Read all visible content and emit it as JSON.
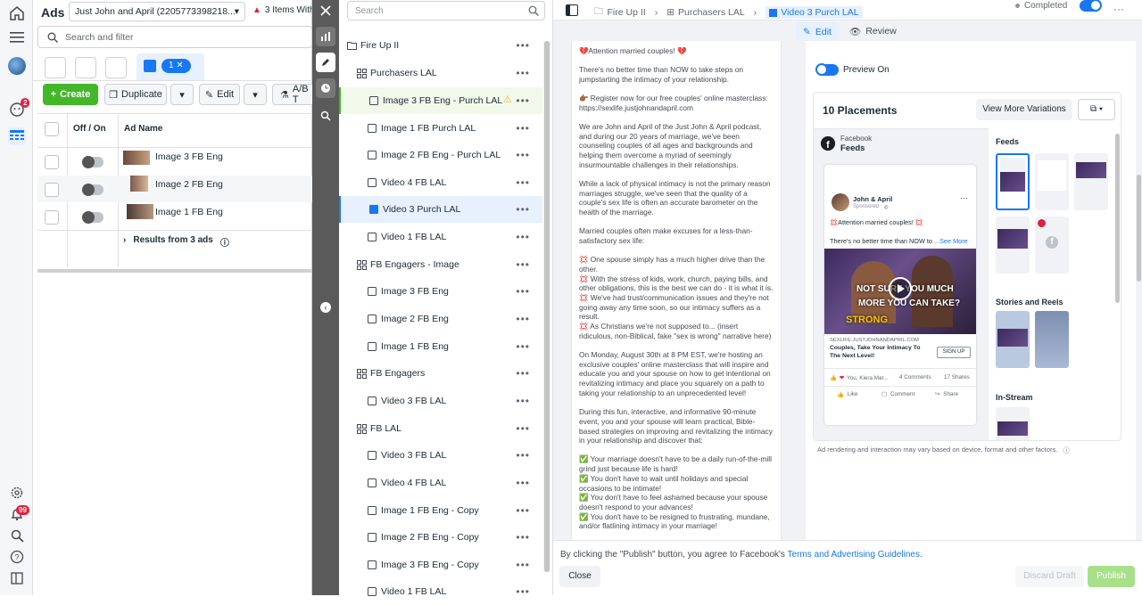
{
  "rail": {
    "notif_badge": "2",
    "alerts_badge": "99"
  },
  "ads": {
    "title": "Ads",
    "account": "Just John and April (2205773398218...",
    "warning": "3 Items With",
    "search_placeholder": "Search and filter",
    "selected_count": "1",
    "create": "Create",
    "duplicate": "Duplicate",
    "edit": "Edit",
    "ab": "A/B T",
    "col_onoff": "Off / On",
    "col_name": "Ad Name",
    "rows": [
      "Image 3 FB Eng",
      "Image 2 FB Eng",
      "Image 1 FB Eng"
    ],
    "results": "Results from 3 ads"
  },
  "tree": {
    "search_placeholder": "Search",
    "items": [
      {
        "label": "Fire Up II",
        "type": "campaign"
      },
      {
        "label": "Purchasers LAL",
        "type": "adset"
      },
      {
        "label": "Image 3 FB Eng - Purch LAL",
        "type": "ad",
        "warn": true
      },
      {
        "label": "Image 1 FB Purch LAL",
        "type": "ad"
      },
      {
        "label": "Image 2 FB Eng - Purch LAL",
        "type": "ad"
      },
      {
        "label": "Video 4 FB LAL",
        "type": "ad"
      },
      {
        "label": "Video 3 Purch LAL",
        "type": "ad",
        "selected": true
      },
      {
        "label": "Video 1 FB LAL",
        "type": "ad"
      },
      {
        "label": "FB Engagers - Image",
        "type": "adset"
      },
      {
        "label": "Image 3 FB Eng",
        "type": "ad"
      },
      {
        "label": "Image 2 FB Eng",
        "type": "ad"
      },
      {
        "label": "Image 1 FB Eng",
        "type": "ad"
      },
      {
        "label": "FB Engagers",
        "type": "adset"
      },
      {
        "label": "Video 3 FB LAL",
        "type": "ad"
      },
      {
        "label": "FB LAL",
        "type": "adset"
      },
      {
        "label": "Video 3 FB LAL",
        "type": "ad"
      },
      {
        "label": "Video 4 FB LAL",
        "type": "ad"
      },
      {
        "label": "Image 1 FB Eng - Copy",
        "type": "ad"
      },
      {
        "label": "Image 2 FB Eng - Copy",
        "type": "ad"
      },
      {
        "label": "Image 3 FB Eng - Copy",
        "type": "ad"
      },
      {
        "label": "Video 1 FB LAL",
        "type": "ad"
      }
    ]
  },
  "header": {
    "crumb1": "Fire Up II",
    "crumb2": "Purchasers LAL",
    "crumb3": "Video 3 Purch LAL",
    "status": "Completed",
    "edit_tab": "Edit",
    "review_tab": "Review"
  },
  "primary_text": [
    "💔Attention married couples! 💔",
    "There's no better time than NOW to take steps on jumpstarting the intimacy of your relationship.",
    "👉🏾 Register now for our free couples' online masterclass: https://sexlife.justjohnandapril.com",
    "We are John and April of the Just John & April podcast, and during our 20 years of marriage, we've been counseling couples of all ages and backgrounds and helping them overcome a myriad of seemingly insurmountable challenges in their relationships.",
    "While a lack of physical intimacy is not the primary reason marriages struggle, we've seen that the quality of a couple's sex life is often an accurate barometer on the health of the marriage.",
    "Married couples often make excuses for a less-than-satisfactory sex life:",
    "💢 One spouse simply has a much higher drive than the other.\n💢 With the stress of kids, work, church, paying bills, and other obligations, this is the best we can do - it is what it is.\n💢 We've had trust/communication issues and they're not going away any time soon, so our intimacy suffers as a result.\n💢 As Christians we're not supposed to... (insert ridiculous, non-Biblical, fake \"sex is wrong\" narrative here)",
    "On Monday, August 30th at 8 PM EST, we're hosting an exclusive couples' online masterclass that will inspire and educate you and your spouse on how to get intentional on revitalizing intimacy and place you squarely on a path to taking your relationship to an unprecedented level!",
    "During this fun, interactive, and informative 90-minute event, you and your spouse will learn practical, Bible-based strategies on improving and revitalizing the intimacy in your relationship and discover that:",
    "✅ Your marriage doesn't have to be a daily run-of-the-mill grind just because life is hard!\n✅ You don't have to wait until holidays and special occasions to be intimate!\n✅ You don't have to feel ashamed because your spouse doesn't respond to your advances!\n✅ You don't have to be resigned to frustrating, mundane, and/or flatlining intimacy in your marriage!"
  ],
  "preview": {
    "toggle_label": "Preview On",
    "placements_title": "10 Placements",
    "view_more": "View More Variations",
    "platform": "Facebook",
    "placement": "Feeds",
    "page_name": "John & April",
    "sponsored": "Sponsored · ",
    "post_line1": "💢Attention married couples! 💢",
    "post_line2": "There's no better time than NOW to",
    "see_more": "...See More",
    "video_overlay1": "NOT SURE YOU MUCH",
    "video_overlay2": "MORE YOU CAN TAKE?",
    "video_overlay3": "STRONG",
    "link_domain": "SEXLIFE.JUSTJOHNANDAPRIL.COM",
    "link_title": "Couples, Take Your Intimacy To The Next Level!",
    "cta": "SIGN UP",
    "reactions": "You, Kiera Mar...",
    "comments": "4 Comments",
    "shares": "17 Shares",
    "like": "Like",
    "comment": "Comment",
    "share": "Share",
    "sec_feeds": "Feeds",
    "sec_stories": "Stories and Reels",
    "sec_instream": "In-Stream",
    "disclaimer": "Ad rendering and interaction may vary based on device, format and other factors."
  },
  "footer": {
    "agree_prefix": "By clicking the \"Publish\" button, you agree to Facebook's ",
    "agree_link": "Terms and Advertising Guidelines",
    "agree_suffix": ".",
    "close": "Close",
    "discard": "Discard Draft",
    "publish": "Publish"
  }
}
